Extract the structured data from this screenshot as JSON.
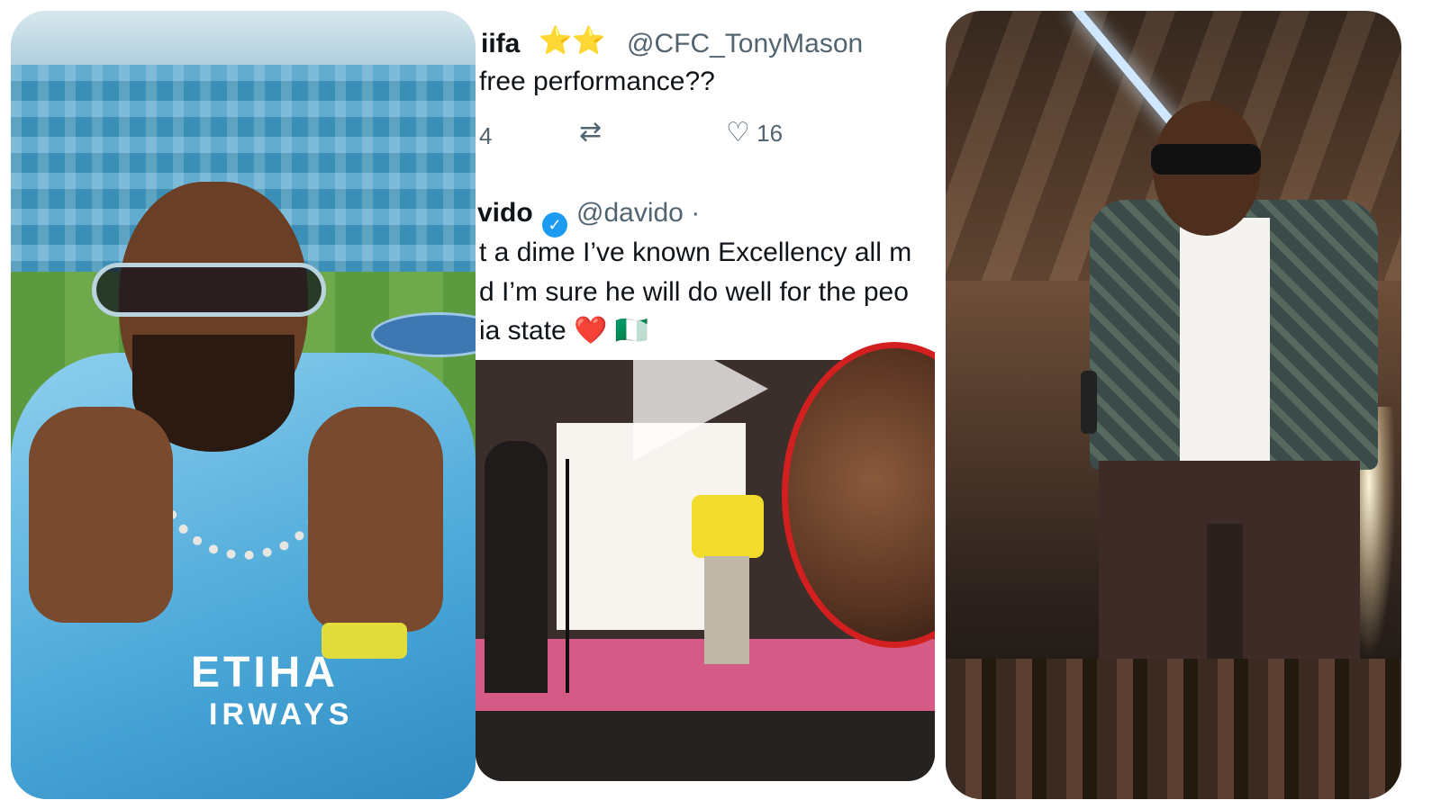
{
  "left_photo": {
    "shirt_text_line1": "ETIHA",
    "shirt_text_line2": "IRWAYS"
  },
  "tweet": {
    "reply": {
      "name_fragment": "iifa",
      "stars": "⭐⭐",
      "handle": "@CFC_TonyMason",
      "text": "free performance??",
      "reply_count": "4",
      "like_count": "16"
    },
    "post": {
      "name_fragment": "vido",
      "handle": "@davido ·",
      "line1": "t a dime I’ve known Excellency all m",
      "line2": "d I’m sure he will do well for the peo",
      "line3": "ia state ❤️ 🇳🇬"
    }
  },
  "icons": {
    "retweet": "retweet-icon",
    "like": "heart-icon",
    "verified": "verified-icon",
    "play": "play-icon"
  },
  "colors": {
    "frame": "#ffffff",
    "zoom_ring": "#d22020",
    "verified_blue": "#1d9bf0"
  }
}
